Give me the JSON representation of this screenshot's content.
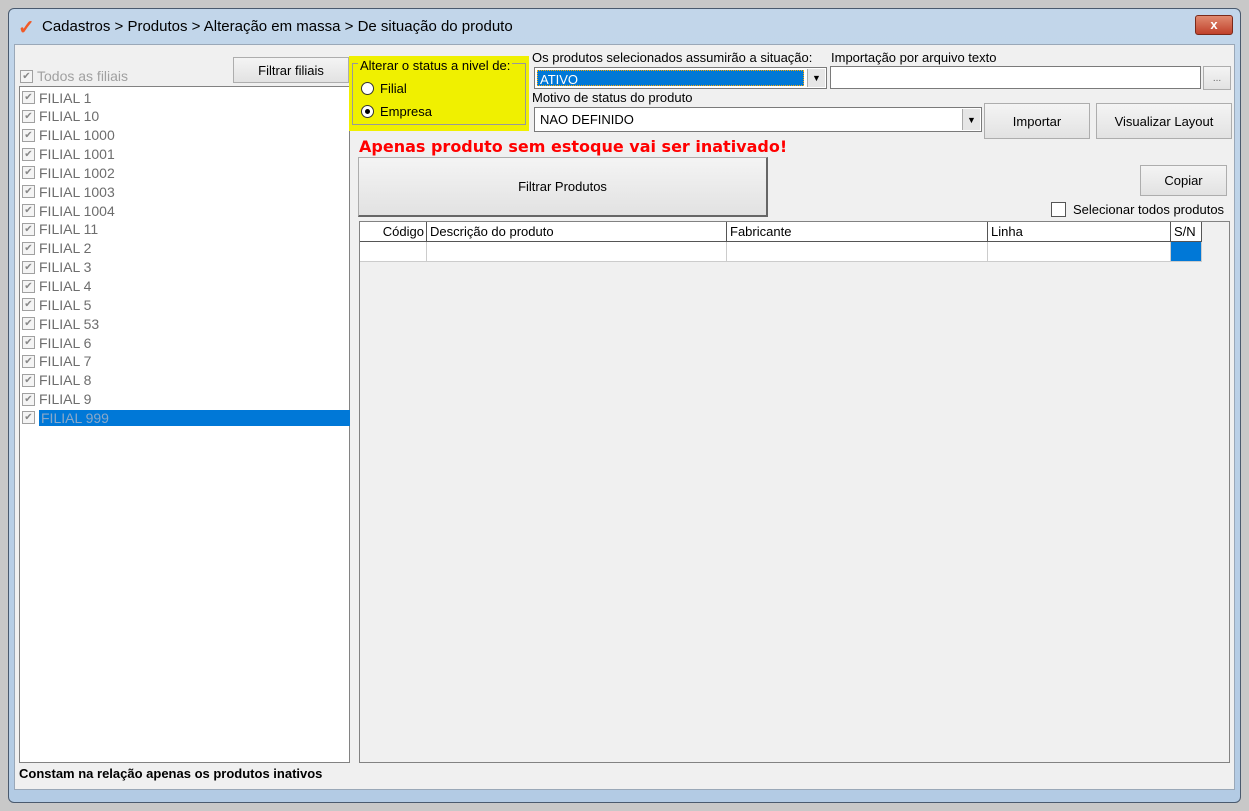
{
  "window": {
    "title": "Cadastros > Produtos > Alteração em massa > De situação do produto",
    "close_label": "x"
  },
  "filiais": {
    "filter_button": "Filtrar filiais",
    "all_label": "Todos as filiais",
    "items": [
      "FILIAL 1",
      "FILIAL 10",
      "FILIAL 1000",
      "FILIAL 1001",
      "FILIAL 1002",
      "FILIAL 1003",
      "FILIAL 1004",
      "FILIAL 11",
      "FILIAL 2",
      "FILIAL 3",
      "FILIAL 4",
      "FILIAL 5",
      "FILIAL 53",
      "FILIAL 6",
      "FILIAL 7",
      "FILIAL 8",
      "FILIAL 9",
      "FILIAL 999"
    ],
    "selected": "FILIAL 999"
  },
  "status_level": {
    "legend": "Alterar o status a nivel de:",
    "options": [
      "Filial",
      "Empresa"
    ],
    "selected": "Empresa"
  },
  "situacao": {
    "label": "Os produtos selecionados assumirão a situação:",
    "value": "ATIVO"
  },
  "importacao": {
    "label": "Importação por arquivo texto",
    "value": "",
    "browse_label": "...",
    "import_button": "Importar",
    "layout_button": "Visualizar Layout"
  },
  "motivo": {
    "label": "Motivo de status do produto",
    "value": "NAO DEFINIDO"
  },
  "warning": "Apenas produto sem estoque vai ser inativado!",
  "filter_products_button": "Filtrar Produtos",
  "copy_button": "Copiar",
  "select_all_products": "Selecionar todos produtos",
  "grid": {
    "columns": [
      "Código",
      "Descrição do produto",
      "Fabricante",
      "Linha",
      "S/N"
    ]
  },
  "footer": "Constam na relação apenas os produtos inativos",
  "colors": {
    "accent": "#0078d7",
    "warning": "#ff0000",
    "highlight": "#f0f000"
  }
}
